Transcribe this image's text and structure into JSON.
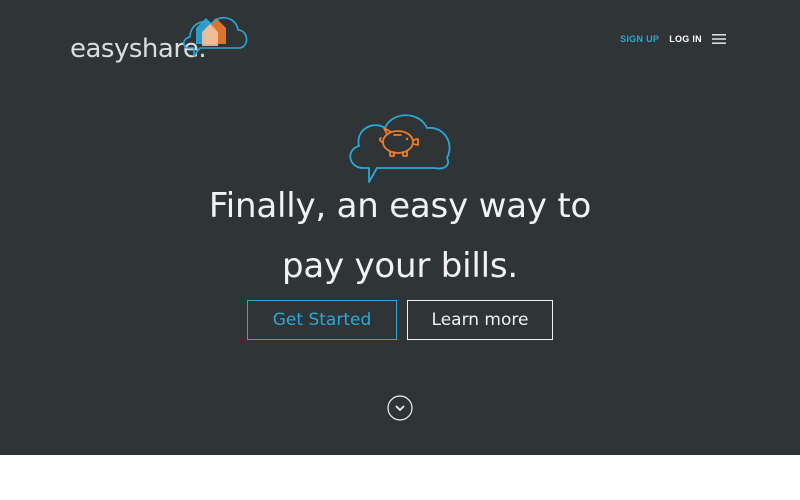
{
  "header": {
    "logo_text": "easyshare.",
    "nav": {
      "signup_label": "SIGN UP",
      "login_label": "LOG IN"
    }
  },
  "hero": {
    "headline_line1": "Finally, an easy way to",
    "headline_line2": "pay your bills.",
    "get_started_label": "Get Started",
    "learn_more_label": "Learn more"
  },
  "colors": {
    "hero_background": "#2f3437",
    "accent_blue": "#2aa9d8",
    "accent_orange": "#f07c2a",
    "text_light": "#f2f2f2"
  },
  "icons": {
    "logo_mark": "house-cloud-icon",
    "hero_icon": "piggy-bank-cloud-icon",
    "menu": "hamburger-menu-icon",
    "scroll": "chevron-down-circle-icon"
  }
}
